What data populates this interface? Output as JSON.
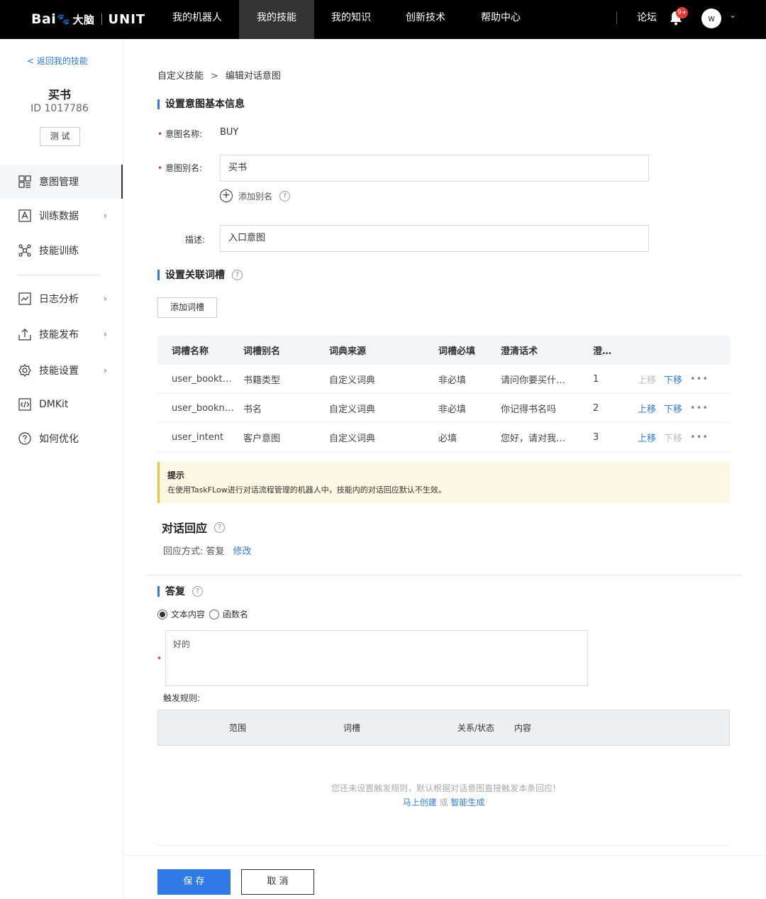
{
  "header": {
    "logo_text": "Bai",
    "logo_suffix": "大脑",
    "logo_unit": "UNIT",
    "nav": [
      {
        "label": "我的机器人"
      },
      {
        "label": "我的技能"
      },
      {
        "label": "我的知识"
      },
      {
        "label": "创新技术"
      },
      {
        "label": "帮助中心"
      }
    ],
    "forum": "论坛",
    "notification_badge": "9+",
    "avatar_initial": "w"
  },
  "sidebar": {
    "back": "< 返回我的技能",
    "skill_name": "买书",
    "skill_id": "ID 1017786",
    "test_button": "测 试",
    "items": [
      {
        "label": "意图管理",
        "icon": "intent-manage-icon"
      },
      {
        "label": "训练数据",
        "icon": "training-data-icon"
      },
      {
        "label": "技能训练",
        "icon": "skill-train-icon"
      },
      {
        "label": "日志分析",
        "icon": "log-analysis-icon"
      },
      {
        "label": "技能发布",
        "icon": "publish-icon"
      },
      {
        "label": "技能设置",
        "icon": "settings-icon"
      },
      {
        "label": "DMKit",
        "icon": "dmkit-icon"
      },
      {
        "label": "如何优化",
        "icon": "help-icon"
      }
    ]
  },
  "main": {
    "breadcrumb": {
      "parent": "自定义技能",
      "sep": ">",
      "current": "编辑对话意图"
    },
    "basic_info": {
      "title": "设置意图基本信息",
      "name_label": "意图名称:",
      "name_value": "BUY",
      "alias_label": "意图别名:",
      "alias_value": "买书",
      "add_alias": "添加别名",
      "desc_label": "描述:",
      "desc_value": "入口意图"
    },
    "slots": {
      "title": "设置关联词槽",
      "add_button": "添加词槽",
      "columns": [
        "词槽名称",
        "词槽别名",
        "词典来源",
        "词槽必填",
        "澄清话术",
        "澄…"
      ],
      "rows": [
        {
          "name": "user_bookt…",
          "alias": "书籍类型",
          "source": "自定义词典",
          "required": "非必填",
          "prompt": "请问你要买什…",
          "order": "1",
          "up": "上移",
          "down": "下移",
          "more": "•••"
        },
        {
          "name": "user_bookn…",
          "alias": "书名",
          "source": "自定义词典",
          "required": "非必填",
          "prompt": "你记得书名吗",
          "order": "2",
          "up": "上移",
          "down": "下移",
          "more": "•••"
        },
        {
          "name": "user_intent",
          "alias": "客户意图",
          "source": "自定义词典",
          "required": "必填",
          "prompt": "您好，请对我…",
          "order": "3",
          "up": "上移",
          "down": "下移",
          "more": "•••"
        }
      ]
    },
    "tip": {
      "title": "提示",
      "text": "在使用TaskFLow进行对话流程管理的机器人中，技能内的对话回应默认不生效。"
    },
    "response": {
      "title": "对话回应",
      "mode_label": "回应方式: 答复",
      "edit": "修改"
    },
    "answer": {
      "title": "答复",
      "option_text": "文本内容",
      "option_func": "函数名",
      "content": "好的",
      "trigger_label": "触发规则:",
      "rule_columns": [
        "范围",
        "词槽",
        "关系/状态",
        "内容"
      ],
      "empty_text": "您还未设置触发规则，默认根据对话意图直接触发本条回应!",
      "create_now": "马上创建",
      "or": "或",
      "smart_generate": "智能生成"
    },
    "footer": {
      "save": "保 存",
      "cancel": "取 消"
    }
  },
  "colors": {
    "accent": "#2f7ae5",
    "header_bg": "#000000",
    "tip_bg": "#fdf8e4",
    "required": "#e53935"
  }
}
